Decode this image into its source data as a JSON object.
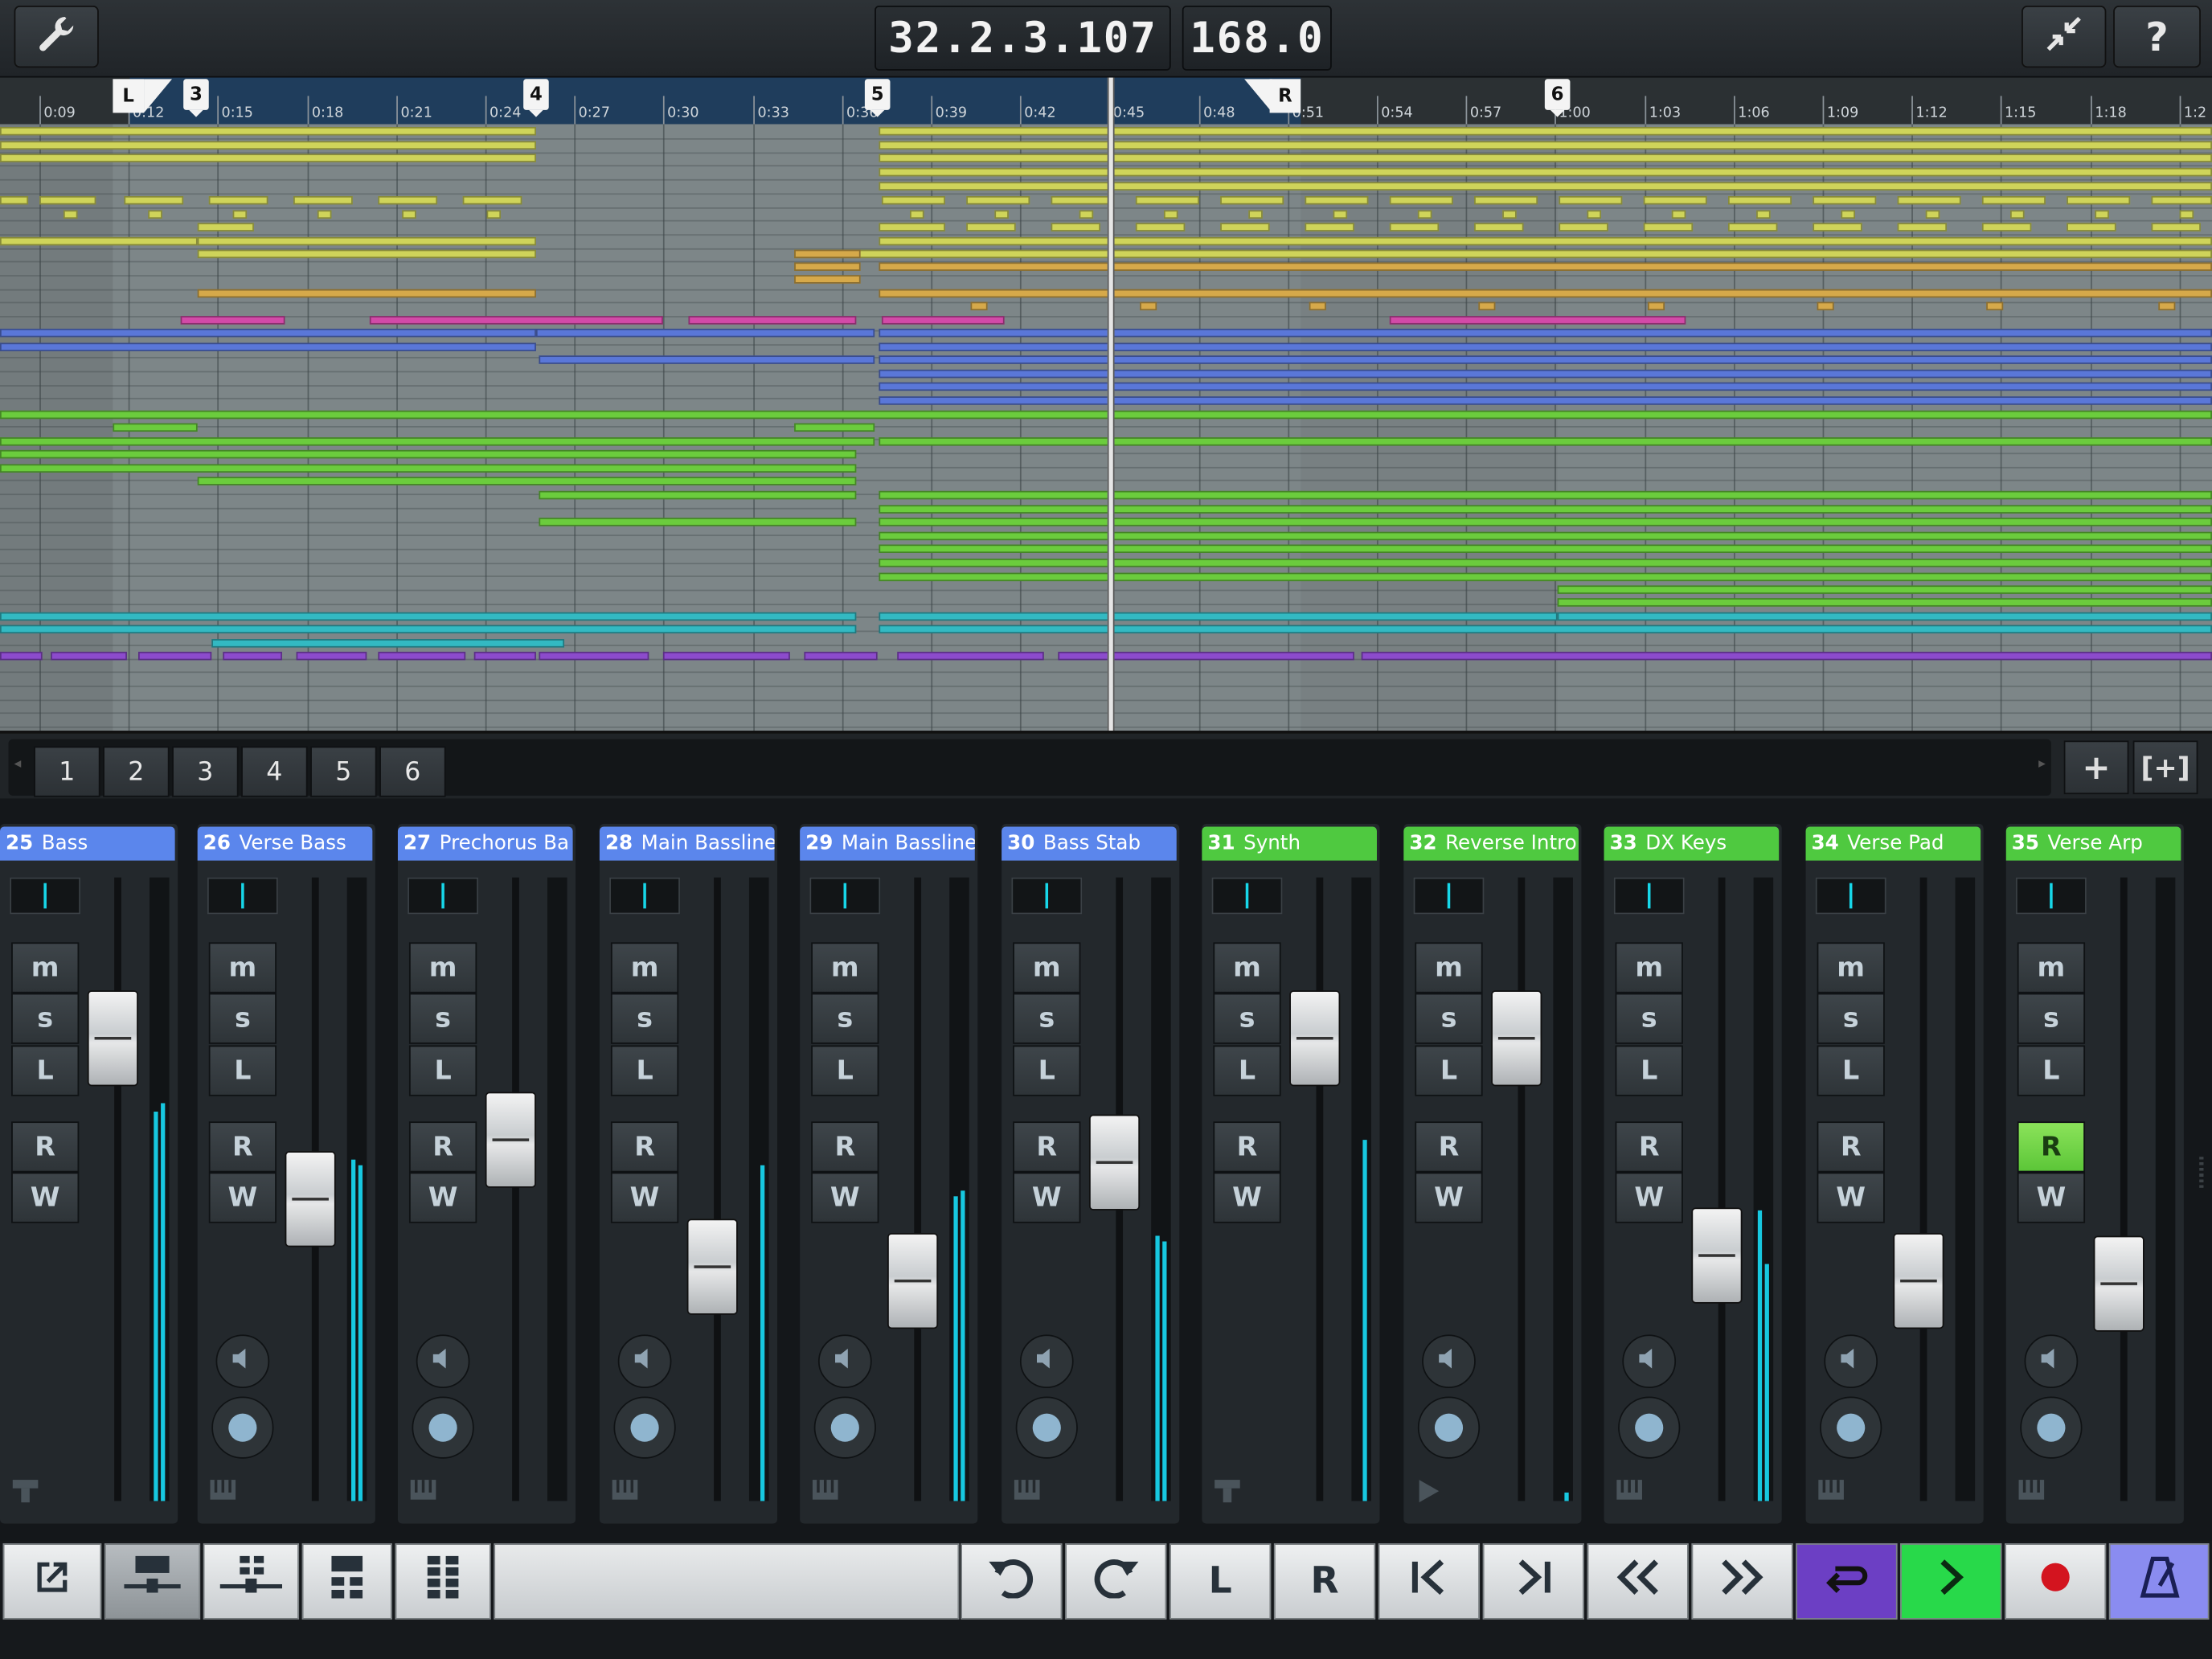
{
  "topbar": {
    "position": "32.2.3.107",
    "tempo": "168.0",
    "help_label": "?"
  },
  "ruler": {
    "time_labels": [
      "0:09",
      "0:12",
      "0:15",
      "0:18",
      "0:21",
      "0:24",
      "0:27",
      "0:30",
      "0:33",
      "0:36",
      "0:39",
      "0:42",
      "0:45",
      "0:48",
      "0:51",
      "0:54",
      "0:57",
      "1:00",
      "1:03",
      "1:06",
      "1:09",
      "1:12",
      "1:15",
      "1:18",
      "1:2"
    ],
    "left_locator": "L",
    "right_locator": "R",
    "markers": [
      "3",
      "4",
      "5",
      "6"
    ]
  },
  "tabs": [
    "1",
    "2",
    "3",
    "4",
    "5",
    "6"
  ],
  "tab_actions": {
    "add": "+",
    "add_folder": "[+]"
  },
  "channels": [
    {
      "number": "25",
      "name": "Bass",
      "color": "#5b86ec",
      "icon": "instrument-icon",
      "record_enabled": false
    },
    {
      "number": "26",
      "name": "Verse Bass",
      "color": "#5b86ec",
      "icon": "keyboard-icon",
      "record_enabled": false
    },
    {
      "number": "27",
      "name": "Prechorus Ba",
      "color": "#5b86ec",
      "icon": "keyboard-icon",
      "record_enabled": false
    },
    {
      "number": "28",
      "name": "Main Bassline",
      "color": "#5b86ec",
      "icon": "keyboard-icon",
      "record_enabled": false
    },
    {
      "number": "29",
      "name": "Main Bassline",
      "color": "#5b86ec",
      "icon": "keyboard-icon",
      "record_enabled": false
    },
    {
      "number": "30",
      "name": "Bass Stab",
      "color": "#5b86ec",
      "icon": "keyboard-icon",
      "record_enabled": false
    },
    {
      "number": "31",
      "name": "Synth",
      "color": "#4fc940",
      "icon": "instrument-icon",
      "record_enabled": false
    },
    {
      "number": "32",
      "name": "Reverse Intro",
      "color": "#4fc940",
      "icon": "audio-icon",
      "record_enabled": false
    },
    {
      "number": "33",
      "name": "DX Keys",
      "color": "#4fc940",
      "icon": "keyboard-icon",
      "record_enabled": false
    },
    {
      "number": "34",
      "name": "Verse Pad",
      "color": "#4fc940",
      "icon": "keyboard-icon",
      "record_enabled": false
    },
    {
      "number": "35",
      "name": "Verse Arp",
      "color": "#4fc940",
      "icon": "keyboard-icon",
      "record_enabled": true
    }
  ],
  "channel_buttons": {
    "mute": "m",
    "solo": "s",
    "listen": "L",
    "read": "R",
    "write": "W"
  },
  "transport": {
    "left_locator": "L",
    "right_locator": "R",
    "colors": {
      "cycle": "#6c3fc4",
      "play": "#28d94a",
      "metronome": "#8a8cf0",
      "record_dot": "#d3141f"
    }
  }
}
